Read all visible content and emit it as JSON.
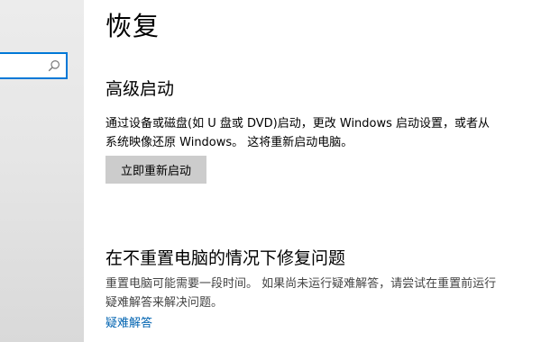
{
  "sidebar": {
    "search": {
      "value": "",
      "placeholder": ""
    }
  },
  "main": {
    "title": "恢复",
    "advanced_startup": {
      "heading": "高级启动",
      "description_line1": "通过设备或磁盘(如 U 盘或 DVD)启动，更改 Windows 启动设置，或者从",
      "description_line2": "系统映像还原 Windows。 这将重新启动电脑。",
      "button_label": "立即重新启动"
    },
    "fix_problems": {
      "heading": "在不重置电脑的情况下修复问题",
      "description_line1": "重置电脑可能需要一段时间。 如果尚未运行疑难解答，请尝试在重置前运行",
      "description_line2": "疑难解答来解决问题。",
      "link_label": "疑难解答"
    }
  },
  "colors": {
    "accent": "#0078d7",
    "link": "#0063b1",
    "button_bg": "#cccccc"
  },
  "icons": {
    "search": "search-icon"
  }
}
